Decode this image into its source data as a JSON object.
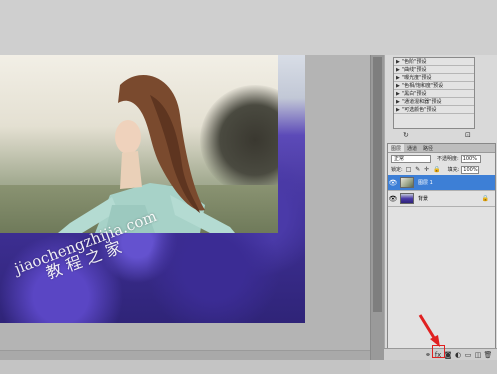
{
  "canvas": {
    "watermark_latin": "jiaochengzhijia.com",
    "watermark_chinese": "教程之家"
  },
  "actions_panel": {
    "items": [
      "\"色阶\"预设",
      "\"曲线\"预设",
      "\"曝光度\"预设",
      "\"色相/饱和度\"预设",
      "\"黑白\"预设",
      "\"通道混和器\"预设",
      "\"可选颜色\"预设"
    ],
    "triangle_icon": "▶",
    "footer_icons": [
      "↻",
      "⊡"
    ]
  },
  "layers_panel": {
    "tabs": [
      "图层",
      "通道",
      "路径"
    ],
    "blend_mode": "正常",
    "opacity_label": "不透明度:",
    "opacity_value": "100%",
    "lock_label": "锁定:",
    "lock_icons": "□ ✎ ✛ 🔒",
    "fill_label": "填充:",
    "fill_value": "100%",
    "layers": [
      {
        "name": "图层 1",
        "selected": true
      },
      {
        "name": "背景",
        "selected": false
      }
    ],
    "eye_icon": "👁",
    "lock_badge": "🔒",
    "footer_icons": [
      "⚭",
      "fx",
      "◙",
      "◐",
      "▭",
      "◫",
      "🗑"
    ]
  },
  "colors": {
    "selection": "#3d7fd6",
    "highlight": "#e02020"
  }
}
